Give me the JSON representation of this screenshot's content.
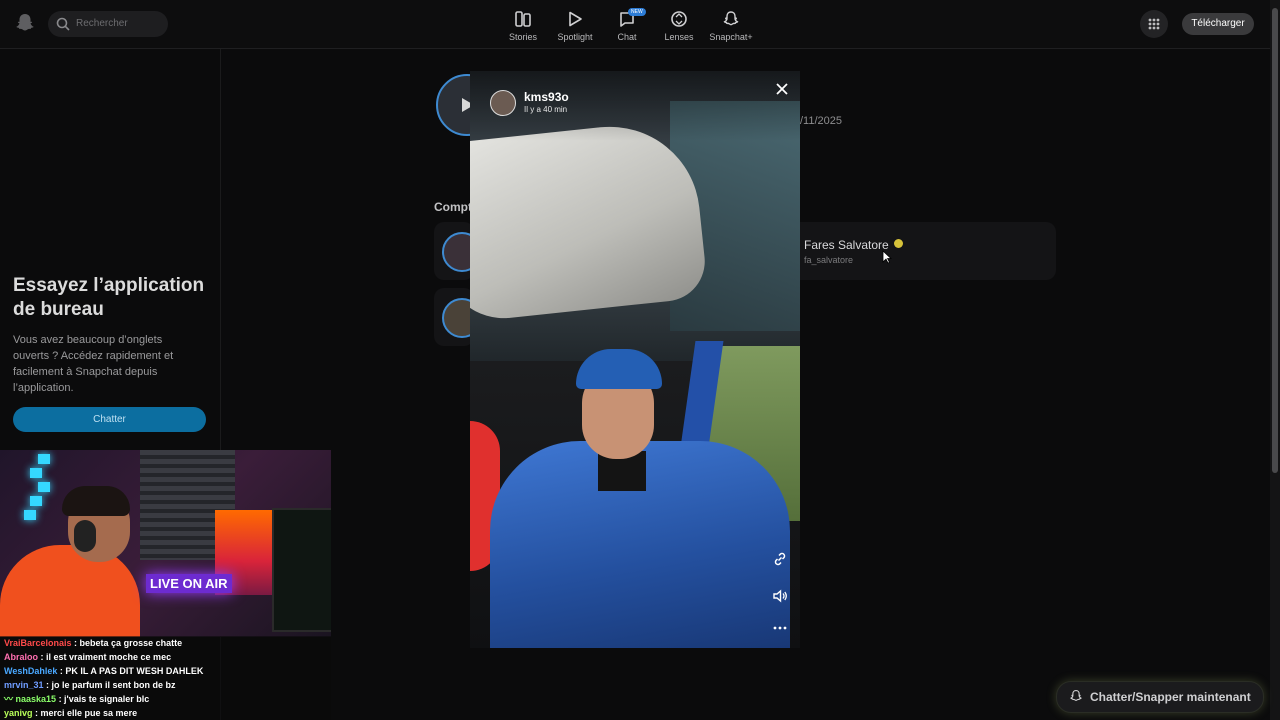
{
  "topbar": {
    "search_placeholder": "Rechercher",
    "nav": [
      {
        "label": "Stories",
        "icon": "stories-icon"
      },
      {
        "label": "Spotlight",
        "icon": "spotlight-icon"
      },
      {
        "label": "Chat",
        "icon": "chat-icon",
        "badge": "NEW"
      },
      {
        "label": "Lenses",
        "icon": "lenses-icon"
      },
      {
        "label": "Snapchat+",
        "icon": "snapchat-plus-icon"
      }
    ],
    "download_label": "Télécharger"
  },
  "left_panel": {
    "title": "Essayez l’application de bureau",
    "text": "Vous avez beaucoup d’onglets ouverts ? Accédez rapidement et facilement à Snapchat depuis l’application.",
    "button_label": "Chatter"
  },
  "profile": {
    "date": "/11/2025",
    "section_label": "Compt",
    "suggested": {
      "name": "Fares Salvatore",
      "username": "fa_salvatore"
    }
  },
  "story": {
    "username": "kms93o",
    "time": "Il y a 40 min",
    "icons": [
      "close-icon",
      "link-icon",
      "sound-icon",
      "more-icon"
    ]
  },
  "stream": {
    "overlay_text": "LIVE ON AIR",
    "chat": [
      {
        "user": "VraiBarcelonais",
        "message": " : bebeta ça grosse chatte",
        "color": "#ff4a4a"
      },
      {
        "user": "Abraloo",
        "message": " : il est vraiment moche ce mec",
        "color": "#ff6fb0"
      },
      {
        "user": "WeshDahlek",
        "message": " : PK IL A PAS DIT WESH DAHLEK",
        "color": "#4aa8ff"
      },
      {
        "user": "mrvin_31",
        "message": " : jo le parfum il sent bon de bz",
        "color": "#6f9cff"
      },
      {
        "user": "naaska15",
        "message": " : j'vais te signaler blc",
        "color": "#8bff6a",
        "prefix": "〰 "
      },
      {
        "user": "yanivg",
        "message": " : merci elle pue sa mere",
        "color": "#b9ff5a"
      }
    ]
  },
  "cta_label": "Chatter/Snapper maintenant",
  "colors": {
    "accent": "#0c6ea0",
    "verified": "#d6c23a",
    "story_ring": "#3e8ad1"
  }
}
